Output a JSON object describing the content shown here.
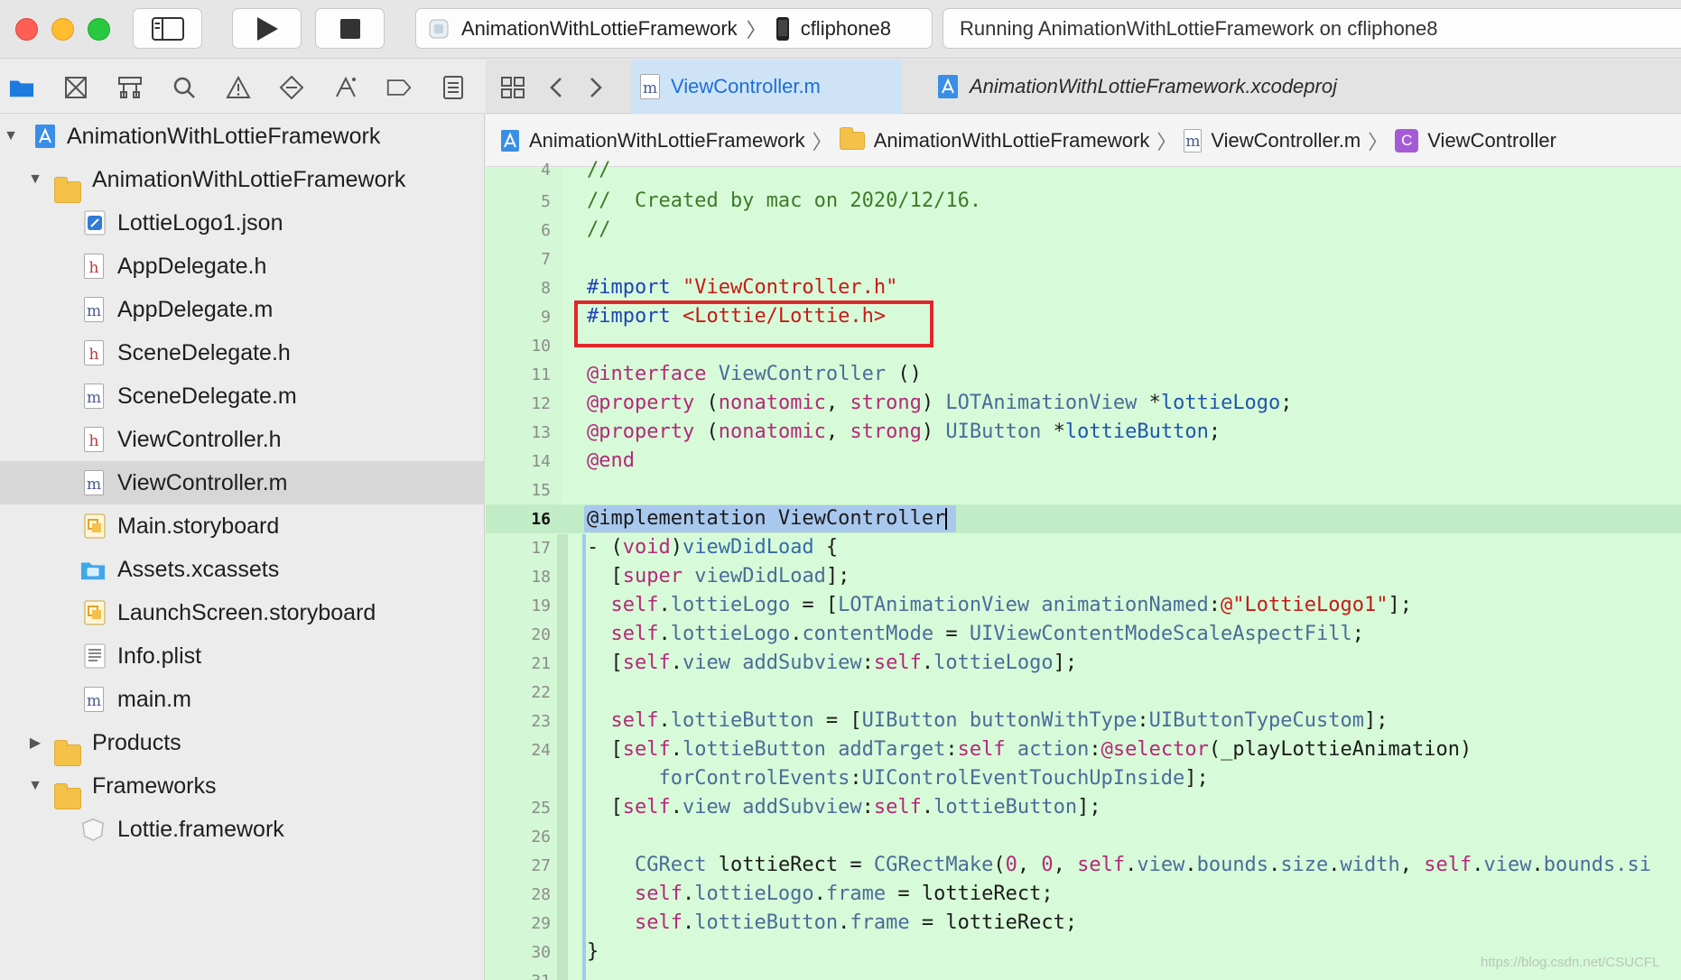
{
  "toolbar": {
    "scheme_project": "AnimationWithLottieFramework",
    "scheme_device": "cfliphone8",
    "status_text": "Running AnimationWithLottieFramework on cfliphone8"
  },
  "navigator": {
    "items": [
      {
        "label": "AnimationWithLottieFramework",
        "icon": "project-icon"
      },
      {
        "label": "AnimationWithLottieFramework",
        "icon": "folder-icon"
      },
      {
        "label": "LottieLogo1.json",
        "icon": "json-file-icon"
      },
      {
        "label": "AppDelegate.h",
        "icon": "header-file-icon",
        "glyph": "h"
      },
      {
        "label": "AppDelegate.m",
        "icon": "source-file-icon",
        "glyph": "m"
      },
      {
        "label": "SceneDelegate.h",
        "icon": "header-file-icon",
        "glyph": "h"
      },
      {
        "label": "SceneDelegate.m",
        "icon": "source-file-icon",
        "glyph": "m"
      },
      {
        "label": "ViewController.h",
        "icon": "header-file-icon",
        "glyph": "h"
      },
      {
        "label": "ViewController.m",
        "icon": "source-file-icon",
        "glyph": "m",
        "selected": true
      },
      {
        "label": "Main.storyboard",
        "icon": "storyboard-icon"
      },
      {
        "label": "Assets.xcassets",
        "icon": "assets-icon"
      },
      {
        "label": "LaunchScreen.storyboard",
        "icon": "storyboard-icon"
      },
      {
        "label": "Info.plist",
        "icon": "plist-icon"
      },
      {
        "label": "main.m",
        "icon": "source-file-icon",
        "glyph": "m"
      },
      {
        "label": "Products",
        "icon": "folder-icon"
      },
      {
        "label": "Frameworks",
        "icon": "folder-icon"
      },
      {
        "label": "Lottie.framework",
        "icon": "framework-icon"
      }
    ]
  },
  "tabs": {
    "active": "ViewController.m",
    "other": "AnimationWithLottieFramework.xcodeproj",
    "active_glyph": "m"
  },
  "jumpbar": {
    "crumbs": [
      "AnimationWithLottieFramework",
      "AnimationWithLottieFramework",
      "ViewController.m",
      "ViewController"
    ],
    "file_glyph": "m",
    "class_glyph": "C"
  },
  "editor": {
    "current_line": "16",
    "line_numbers": [
      "4",
      "5",
      "6",
      "7",
      "8",
      "9",
      "10",
      "11",
      "12",
      "13",
      "14",
      "15",
      "16",
      "17",
      "18",
      "19",
      "20",
      "21",
      "22",
      "23",
      "24",
      "",
      "25",
      "26",
      "27",
      "28",
      "29",
      "30",
      "31"
    ],
    "code": {
      "l4": "//",
      "l5": "//  Created by mac on 2020/12/16.",
      "l6": "//",
      "l8_kw": "#import",
      "l8_str": "\"ViewController.h\"",
      "l9_kw": "#import",
      "l9_str": "<Lottie/Lottie.h>",
      "l11_a": "@interface",
      "l11_b": "ViewController",
      "l11_c": " ()",
      "l12_a": "@property",
      "l12_b": " (",
      "l12_c": "nonatomic",
      "l12_d": ", ",
      "l12_e": "strong",
      "l12_f": ") ",
      "l12_g": "LOTAnimationView",
      "l12_h": " *",
      "l12_i": "lottieLogo",
      "l12_j": ";",
      "l13_a": "@property",
      "l13_b": " (",
      "l13_c": "nonatomic",
      "l13_d": ", ",
      "l13_e": "strong",
      "l13_f": ") ",
      "l13_g": "UIButton",
      "l13_h": " *",
      "l13_i": "lottieButton",
      "l13_j": ";",
      "l14": "@end",
      "l16": "@implementation ViewController",
      "l17_a": "- (",
      "l17_b": "void",
      "l17_c": ")",
      "l17_d": "viewDidLoad",
      "l17_e": " {",
      "l18_a": "  [",
      "l18_b": "super",
      "l18_c": " ",
      "l18_d": "viewDidLoad",
      "l18_e": "];",
      "l19_a": "  ",
      "l19_b": "self",
      "l19_c": ".",
      "l19_d": "lottieLogo",
      "l19_e": " = [",
      "l19_f": "LOTAnimationView",
      "l19_g": " ",
      "l19_h": "animationNamed",
      "l19_i": ":",
      "l19_j": "@\"LottieLogo1\"",
      "l19_k": "];",
      "l20_a": "  ",
      "l20_b": "self",
      "l20_c": ".",
      "l20_d": "lottieLogo",
      "l20_e": ".",
      "l20_f": "contentMode",
      "l20_g": " = ",
      "l20_h": "UIViewContentModeScaleAspectFill",
      "l20_i": ";",
      "l21_a": "  [",
      "l21_b": "self",
      "l21_c": ".",
      "l21_d": "view",
      "l21_e": " ",
      "l21_f": "addSubview",
      "l21_g": ":",
      "l21_h": "self",
      "l21_i": ".",
      "l21_j": "lottieLogo",
      "l21_k": "];",
      "l23_a": "  ",
      "l23_b": "self",
      "l23_c": ".",
      "l23_d": "lottieButton",
      "l23_e": " = [",
      "l23_f": "UIButton",
      "l23_g": " ",
      "l23_h": "buttonWithType",
      "l23_i": ":",
      "l23_j": "UIButtonTypeCustom",
      "l23_k": "];",
      "l24_a": "  [",
      "l24_b": "self",
      "l24_c": ".",
      "l24_d": "lottieButton",
      "l24_e": " ",
      "l24_f": "addTarget",
      "l24_g": ":",
      "l24_h": "self",
      "l24_i": " ",
      "l24_j": "action",
      "l24_k": ":",
      "l24_l": "@selector",
      "l24_m": "(_playLottieAnimation)",
      "l24w_a": "      ",
      "l24w_b": "forControlEvents",
      "l24w_c": ":",
      "l24w_d": "UIControlEventTouchUpInside",
      "l24w_e": "];",
      "l25_a": "  [",
      "l25_b": "self",
      "l25_c": ".",
      "l25_d": "view",
      "l25_e": " ",
      "l25_f": "addSubview",
      "l25_g": ":",
      "l25_h": "self",
      "l25_i": ".",
      "l25_j": "lottieButton",
      "l25_k": "];",
      "l27_a": "    ",
      "l27_b": "CGRect",
      "l27_c": " lottieRect = ",
      "l27_d": "CGRectMake",
      "l27_e": "(",
      "l27_f": "0",
      "l27_g": ", ",
      "l27_h": "0",
      "l27_i": ", ",
      "l27_j": "self",
      "l27_k": ".",
      "l27_l": "view",
      "l27_m": ".",
      "l27_n": "bounds",
      "l27_o": ".",
      "l27_p": "size",
      "l27_q": ".",
      "l27_r": "width",
      "l27_s": ", ",
      "l27_t": "self",
      "l27_u": ".",
      "l27_v": "view",
      "l27_w": ".",
      "l27_x": "bounds",
      "l27_y": ".si",
      "l28_a": "    ",
      "l28_b": "self",
      "l28_c": ".",
      "l28_d": "lottieLogo",
      "l28_e": ".",
      "l28_f": "frame",
      "l28_g": " = lottieRect;",
      "l29_a": "    ",
      "l29_b": "self",
      "l29_c": ".",
      "l29_d": "lottieButton",
      "l29_e": ".",
      "l29_f": "frame",
      "l29_g": " = lottieRect;",
      "l30": "}"
    }
  },
  "watermark": "https://blog.csdn.net/CSUCFL"
}
